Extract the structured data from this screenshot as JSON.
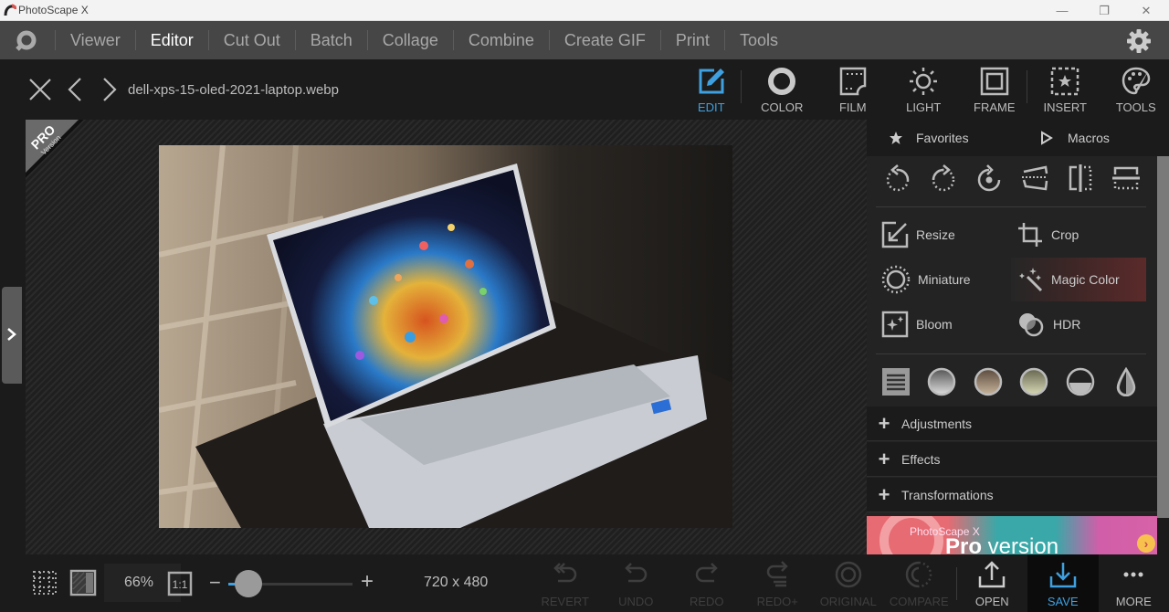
{
  "window": {
    "title": "PhotoScape X",
    "controls": {
      "minimize": "—",
      "restore": "❐",
      "close": "✕"
    }
  },
  "menu": {
    "items": [
      {
        "label": "Viewer",
        "active": false
      },
      {
        "label": "Editor",
        "active": true
      },
      {
        "label": "Cut Out",
        "active": false
      },
      {
        "label": "Batch",
        "active": false
      },
      {
        "label": "Collage",
        "active": false
      },
      {
        "label": "Combine",
        "active": false
      },
      {
        "label": "Create GIF",
        "active": false
      },
      {
        "label": "Print",
        "active": false
      },
      {
        "label": "Tools",
        "active": false
      }
    ],
    "settings_icon": "gear-icon"
  },
  "file": {
    "name": "dell-xps-15-oled-2021-laptop.webp"
  },
  "tool_tabs": [
    {
      "label": "EDIT",
      "icon": "edit-icon",
      "active": true
    },
    {
      "label": "COLOR",
      "icon": "color-icon",
      "active": false
    },
    {
      "label": "FILM",
      "icon": "film-icon",
      "active": false
    },
    {
      "label": "LIGHT",
      "icon": "light-icon",
      "active": false
    },
    {
      "label": "FRAME",
      "icon": "frame-icon",
      "active": false
    },
    {
      "label": "INSERT",
      "icon": "insert-icon",
      "active": false
    },
    {
      "label": "TOOLS",
      "icon": "tools-icon",
      "active": false
    }
  ],
  "badge": {
    "line1": "PRO",
    "line2": "Version"
  },
  "panel": {
    "favorites_label": "Favorites",
    "macros_label": "Macros",
    "transform_icons": [
      "rotate-left-icon",
      "rotate-right-icon",
      "rotate-free-icon",
      "straighten-icon",
      "flip-horizontal-icon",
      "flip-vertical-icon"
    ],
    "tools": [
      {
        "label": "Resize",
        "icon": "resize-icon"
      },
      {
        "label": "Crop",
        "icon": "crop-icon"
      },
      {
        "label": "Miniature",
        "icon": "miniature-icon"
      },
      {
        "label": "Magic Color",
        "icon": "magic-wand-icon",
        "highlighted": true
      },
      {
        "label": "Bloom",
        "icon": "bloom-icon"
      },
      {
        "label": "HDR",
        "icon": "hdr-icon"
      }
    ],
    "filter_icons": [
      "list-icon",
      "filter-gray-icon",
      "filter-sepia-icon",
      "filter-green-icon",
      "filter-half-icon",
      "drop-icon"
    ],
    "sections": [
      {
        "label": "Adjustments"
      },
      {
        "label": "Effects"
      },
      {
        "label": "Transformations"
      }
    ],
    "ad": {
      "line1": "PhotoScape X",
      "line2_bold": "Pro",
      "line2_rest": " version"
    }
  },
  "status": {
    "zoom": "66%",
    "one_to_one": "1:1",
    "zoom_slider_fraction": 0.16,
    "dimensions": "720 x 480",
    "minus": "−",
    "plus": "+"
  },
  "actions": [
    {
      "label": "REVERT",
      "icon": "revert-icon",
      "enabled": false
    },
    {
      "label": "UNDO",
      "icon": "undo-icon",
      "enabled": false
    },
    {
      "label": "REDO",
      "icon": "redo-icon",
      "enabled": false
    },
    {
      "label": "REDO+",
      "icon": "redo-plus-icon",
      "enabled": false
    },
    {
      "label": "ORIGINAL",
      "icon": "original-icon",
      "enabled": false
    },
    {
      "label": "COMPARE",
      "icon": "compare-icon",
      "enabled": false
    },
    {
      "label": "OPEN",
      "icon": "open-icon",
      "enabled": true
    },
    {
      "label": "SAVE",
      "icon": "save-icon",
      "enabled": true
    },
    {
      "label": "MORE",
      "icon": "more-icon",
      "enabled": true
    }
  ],
  "colors": {
    "accent": "#3ea0e0",
    "highlight": "#5b2a2a",
    "menubar": "#464646",
    "background": "#1b1b1b"
  }
}
